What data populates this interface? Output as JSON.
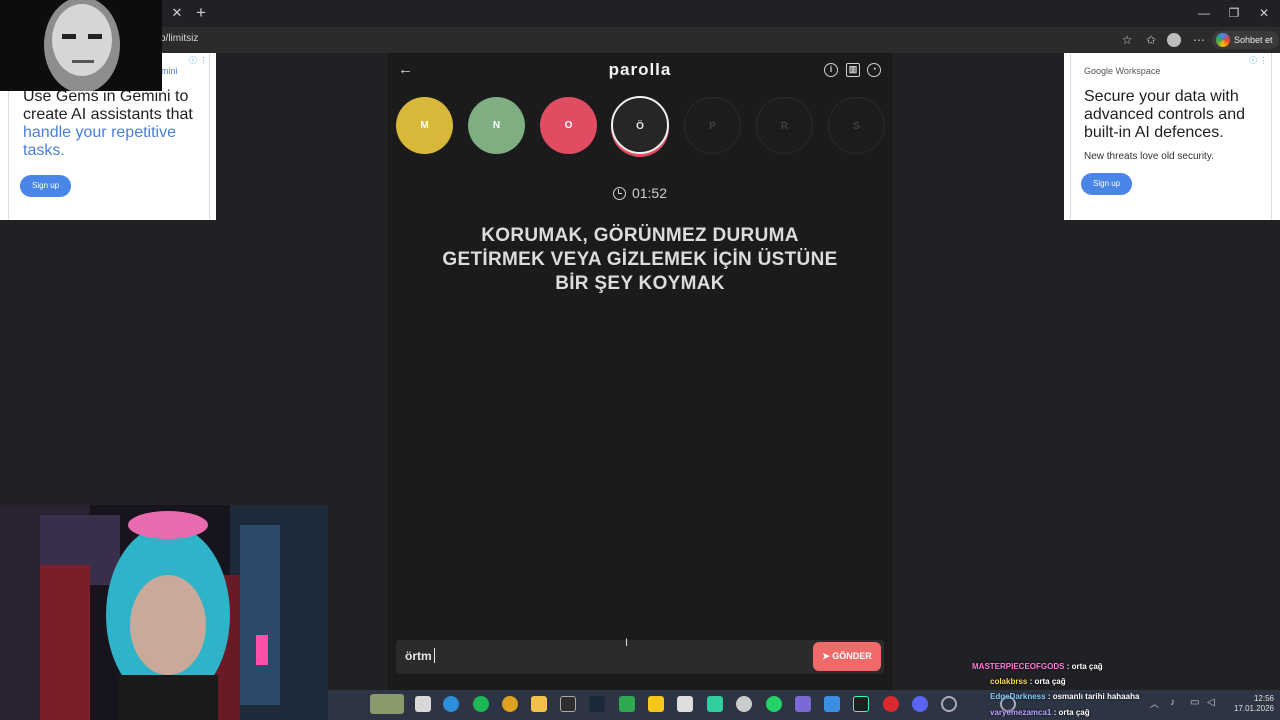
{
  "browser": {
    "url": "p/limitsiz",
    "chat_button": "Sohbet et",
    "controls": {
      "minimize": "—",
      "restore": "❐",
      "close": "✕"
    }
  },
  "ads": {
    "left": {
      "brand_fragment": "mini",
      "headline_plain": "Use Gems in Gemini to create AI assistants that",
      "headline_highlight": "handle your repetitive tasks.",
      "cta": "Sign up"
    },
    "right": {
      "brand": "Google Workspace",
      "headline": "Secure your data with advanced controls and built-in AI defences.",
      "sub": "New threats love old security.",
      "cta": "Sign up"
    }
  },
  "app": {
    "title": "parolla",
    "letters": [
      {
        "char": "M",
        "state": "correct",
        "color": "#d8b838"
      },
      {
        "char": "N",
        "state": "passed",
        "color": "#7fae83"
      },
      {
        "char": "O",
        "state": "wrong",
        "color": "#e04d63"
      },
      {
        "char": "Ö",
        "state": "active"
      },
      {
        "char": "P",
        "state": "pending"
      },
      {
        "char": "R",
        "state": "pending"
      },
      {
        "char": "S",
        "state": "pending"
      }
    ],
    "timer": "01:52",
    "question": "KORUMAK, GÖRÜNMEZ DURUMA GETİRMEK VEYA GİZLEMEK İÇİN ÜSTÜNE BİR ŞEY KOYMAK",
    "answer_value": "örtm",
    "send_label": "GÖNDER"
  },
  "chat": [
    {
      "user": "MASTERPIECEOFGODS",
      "message": ": orta çağ",
      "color": "#ff7ad9"
    },
    {
      "user": "colakbrss",
      "message": ": orta çağ",
      "color": "#ffd84a"
    },
    {
      "user": "EdgeDarkness",
      "message": ": osmanlı tarihi hahaaha",
      "color": "#7fd0ff"
    },
    {
      "user": "varyemezamca1",
      "message": ": orta çağ",
      "color": "#b7a4ff"
    }
  ],
  "taskbar": {
    "time": "12:56",
    "date": "17.01.2026"
  }
}
